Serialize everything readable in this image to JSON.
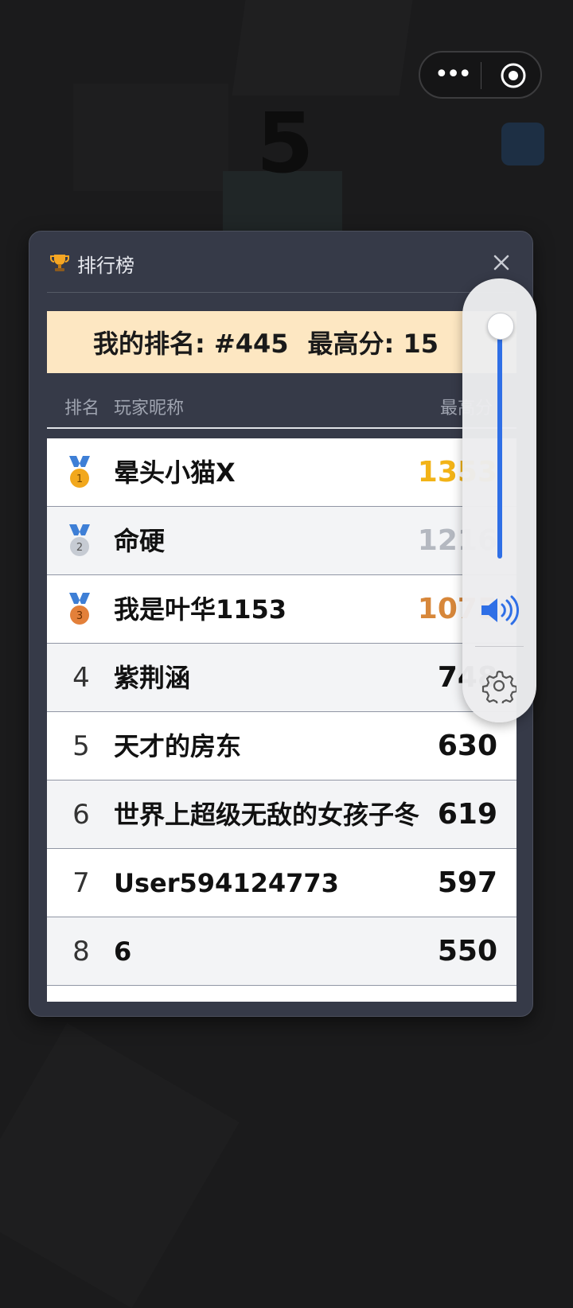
{
  "background": {
    "current_score": "5"
  },
  "capsule": {
    "more_icon": "more-dots-icon",
    "exit_icon": "target-circle-icon"
  },
  "leaderboard": {
    "title": "排行榜",
    "my_rank_label": "我的排名: #445",
    "my_best_label": "最高分: 15",
    "columns": {
      "rank": "排名",
      "name": "玩家昵称",
      "score": "最高分"
    },
    "rows": [
      {
        "rank": "1",
        "medal": "gold-medal-icon",
        "name": "晕头小猫X",
        "score": "1353"
      },
      {
        "rank": "2",
        "medal": "silver-medal-icon",
        "name": "命硬",
        "score": "1216"
      },
      {
        "rank": "3",
        "medal": "bronze-medal-icon",
        "name": "我是叶华1153",
        "score": "1075"
      },
      {
        "rank": "4",
        "name": "紫荆涵",
        "score": "748"
      },
      {
        "rank": "5",
        "name": "天才的房东",
        "score": "630"
      },
      {
        "rank": "6",
        "name": "世界上超级无敌的女孩子冬",
        "score": "619"
      },
      {
        "rank": "7",
        "name": "User594124773",
        "score": "597"
      },
      {
        "rank": "8",
        "name": "6",
        "score": "550"
      }
    ]
  },
  "volume": {
    "level": 1.0,
    "accent": "#2f6fe6"
  },
  "colors": {
    "gold": "#f2b317",
    "silver": "#b4b8c0",
    "bronze": "#d7873a",
    "my_rank_bg": "#fde7c2"
  }
}
